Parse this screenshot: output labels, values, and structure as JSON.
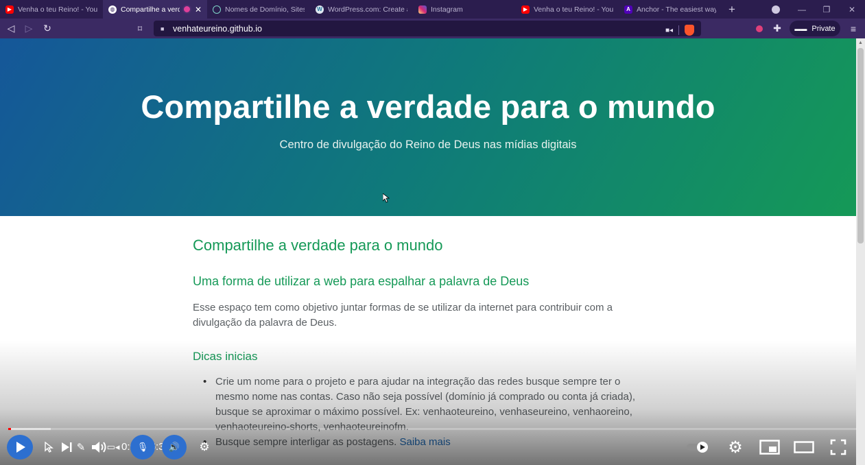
{
  "browser": {
    "tabs": [
      {
        "title": "Venha o teu Reino! - YouTu",
        "favicon": "youtube-icon",
        "active": false
      },
      {
        "title": "Compartilhe a verd",
        "favicon": "globe-icon",
        "active": true
      },
      {
        "title": "Nomes de Domínio, Sites n",
        "favicon": "hostinger-icon",
        "active": false
      },
      {
        "title": "WordPress.com: Create a Fr",
        "favicon": "wordpress-icon",
        "active": false
      },
      {
        "title": "Instagram",
        "favicon": "instagram-icon",
        "active": false
      },
      {
        "title": "Venha o teu Reino! - YouTu",
        "favicon": "youtube-icon",
        "active": false
      },
      {
        "title": "Anchor - The easiest way t",
        "favicon": "anchor-icon",
        "active": false
      }
    ],
    "url": "venhateureino.github.io",
    "private_label": "Private"
  },
  "page": {
    "hero_title": "Compartilhe a verdade para o mundo",
    "hero_subtitle": "Centro de divulgação do Reino de Deus nas mídias digitais",
    "heading": "Compartilhe a verdade para o mundo",
    "subheading": "Uma forma de utilizar a web para espalhar a palavra de Deus",
    "intro": "Esse espaço tem como objetivo juntar formas de se utilizar da internet para contribuir com a divulgação da palavra de Deus.",
    "tips_heading": "Dicas inicias",
    "tips": [
      "Crie um nome para o projeto e para ajudar na integração das redes busque sempre ter o mesmo nome nas contas. Caso não seja possível (domínio já comprado ou conta já criada), busque se aproximar o máximo possível. Ex: venhaoteureino, venhaseureino, venhaoreino, venhaoteureino-shorts, venhaoteureinofm.",
      "Busque sempre interligar as postagens."
    ],
    "tips_link": "Saiba mais"
  },
  "player": {
    "time": "0:00 / 6:31",
    "progress_played": 0.003,
    "progress_loaded": 0.05
  },
  "colors": {
    "hero_start": "#155799",
    "hero_end": "#159957",
    "heading": "#159957",
    "link": "#1e6bb8",
    "browser_frame": "#2b1d4e"
  }
}
